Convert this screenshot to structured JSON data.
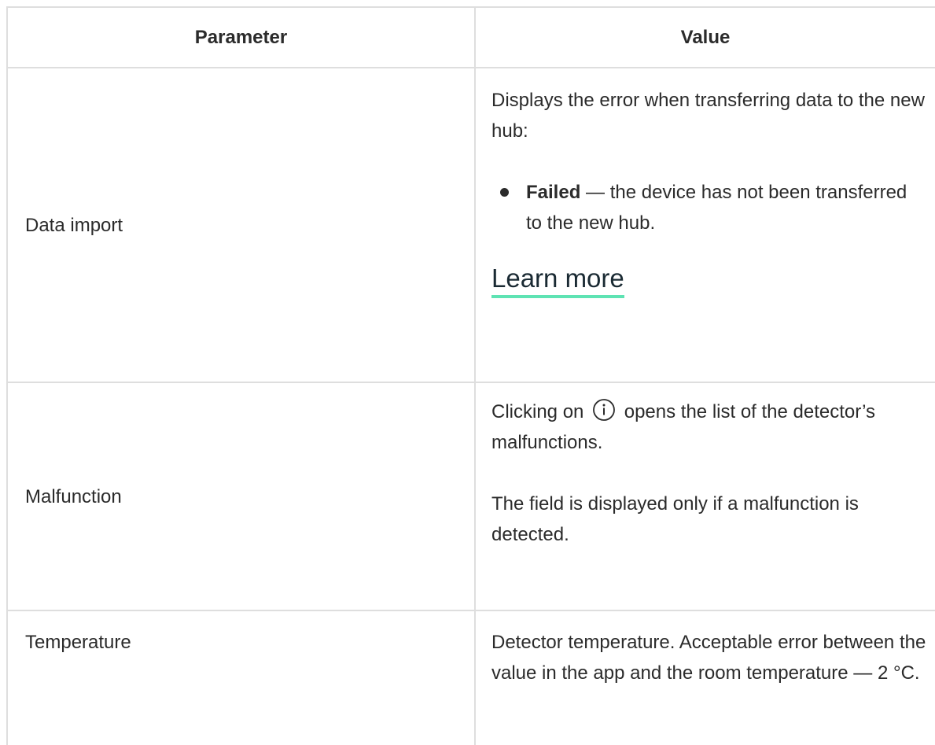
{
  "table": {
    "headers": {
      "parameter": "Parameter",
      "value": "Value"
    },
    "rows": [
      {
        "parameter": "Data import",
        "value_intro": "Displays the error when transferring data to the new hub:",
        "bullets": [
          {
            "term": "Failed",
            "text": " — the device has not been transferred to the new hub."
          }
        ],
        "link": "Learn more"
      },
      {
        "parameter": "Malfunction",
        "value_before_icon": "Clicking on ",
        "icon": "info-circle-icon",
        "value_after_icon": " opens the list of the detector’s malfunctions.",
        "value_note": "The field is displayed only if a malfunction is detected."
      },
      {
        "parameter": "Temperature",
        "value": "Detector temperature. Acceptable error between the value in the app and the room temperature — 2 °C."
      }
    ]
  },
  "colors": {
    "border": "#dedede",
    "link_underline": "#5ee3b3",
    "text": "#2b2b2b"
  }
}
